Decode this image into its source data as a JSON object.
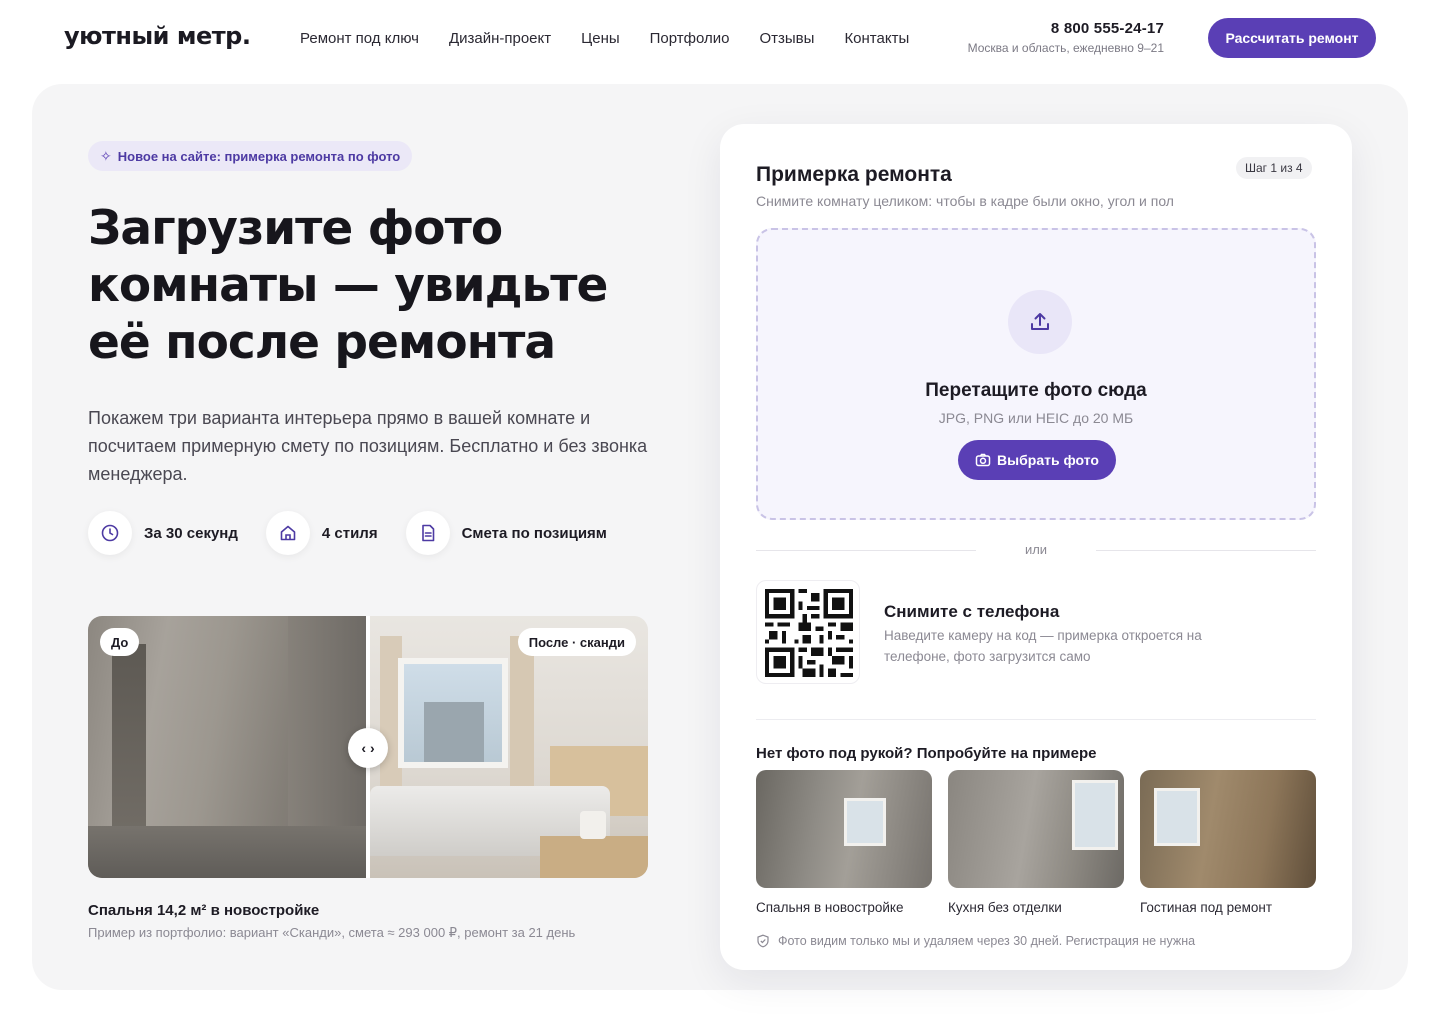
{
  "header": {
    "logo": "уютный метр.",
    "nav": [
      "Ремонт под ключ",
      "Дизайн-проект",
      "Цены",
      "Портфолио",
      "Отзывы",
      "Контакты"
    ],
    "phone": "8 800 555-24-17",
    "hours": "Москва и область, ежедневно 9–21",
    "cta": "Рассчитать ремонт"
  },
  "hero": {
    "badge": "Новое на сайте: примерка ремонта по фото",
    "title": "Загрузите фото комнаты — увидьте её после ремонта",
    "lead": "Покажем три варианта интерьера прямо в вашей комнате и посчитаем примерную смету по позициям. Бесплатно и без звонка менеджера.",
    "features": [
      {
        "icon": "clock-icon",
        "label": "За 30 секунд"
      },
      {
        "icon": "home-icon",
        "label": "4 стиля"
      },
      {
        "icon": "document-icon",
        "label": "Смета по позициям"
      }
    ],
    "compare": {
      "before_label": "До",
      "after_label": "После · сканди",
      "handle": "‹ ›"
    },
    "caption_title": "Спальня 14,2 м² в новостройке",
    "caption_sub": "Пример из портфолио: вариант «Сканди», смета ≈ 293 000 ₽, ремонт за 21 день"
  },
  "card": {
    "title": "Примерка ремонта",
    "step": "Шаг 1 из 4",
    "subtitle": "Снимите комнату целиком: чтобы в кадре были окно, угол и пол",
    "drop_title": "Перетащите фото сюда",
    "drop_hint": "JPG, PNG или HEIC до 20 МБ",
    "pick_button": "Выбрать фото",
    "or": "или",
    "phone_title": "Снимите с телефона",
    "phone_text": "Наведите камеру на код — примерка откроется на телефоне, фото загрузится само",
    "samples_title": "Нет фото под рукой? Попробуйте на примере",
    "samples": [
      "Спальня в новостройке",
      "Кухня без отделки",
      "Гостиная под ремонт"
    ],
    "privacy": "Фото видим только мы и удаляем через 30 дней. Регистрация не нужна"
  },
  "colors": {
    "accent": "#5a3fb5",
    "panel": "#f5f5f6",
    "badge_bg": "#ebe8f7",
    "drop_bg": "#f6f5fd"
  }
}
